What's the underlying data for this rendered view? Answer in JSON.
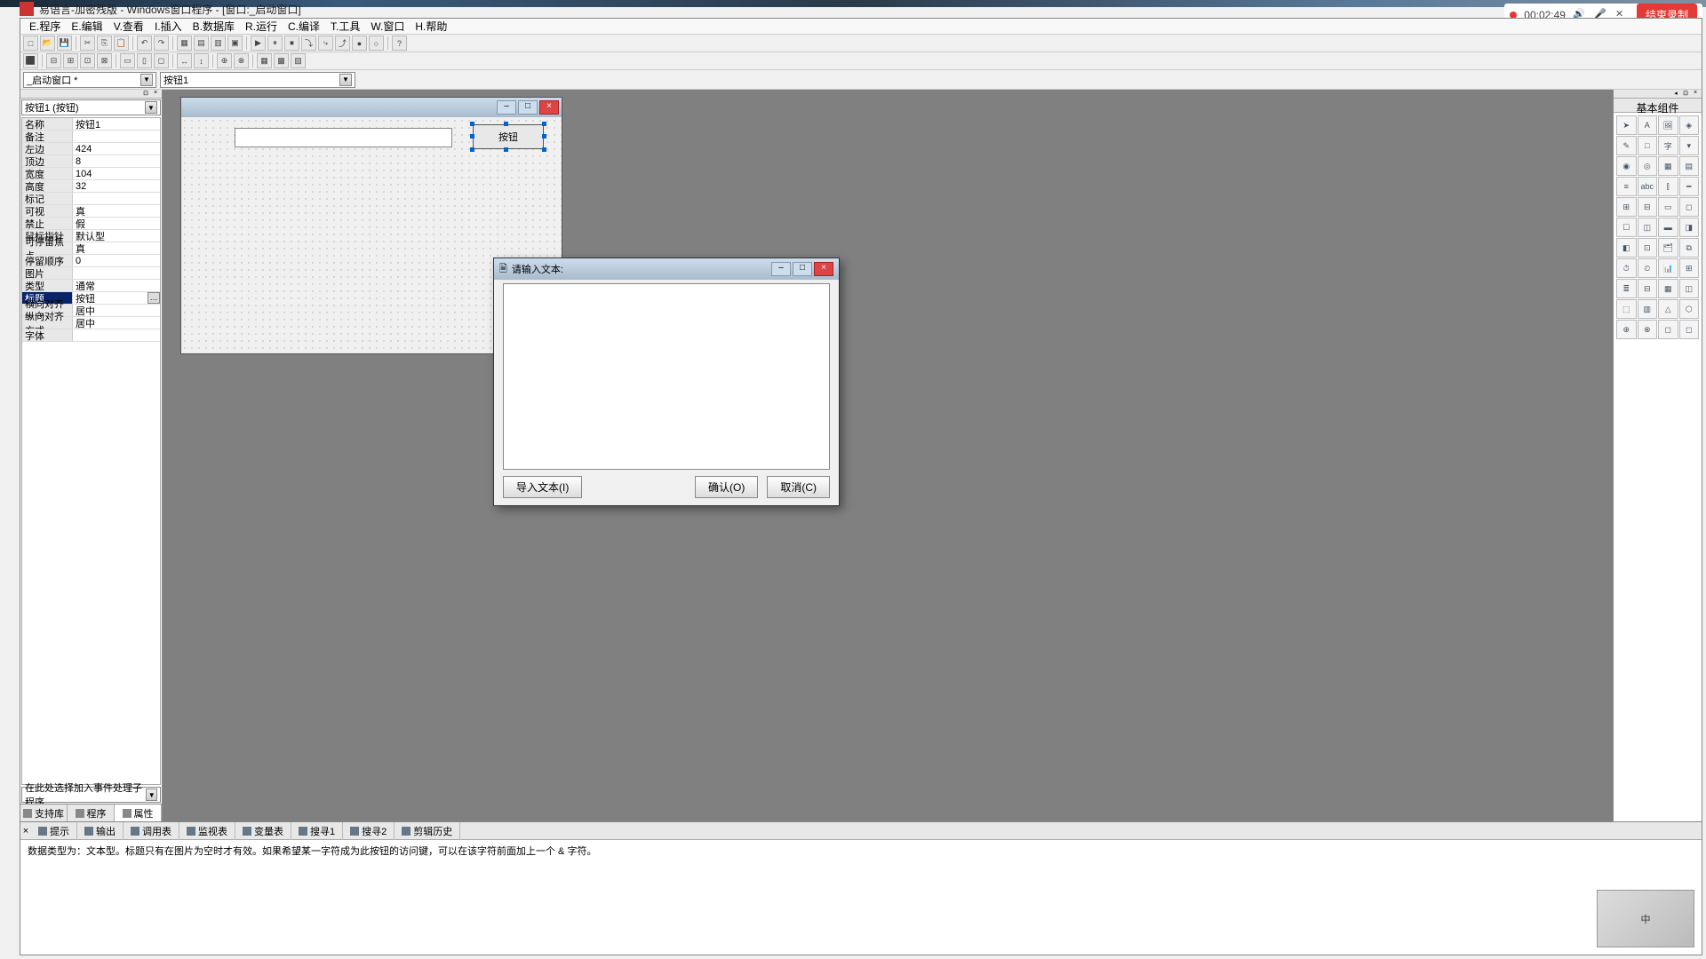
{
  "app": {
    "title": "易语言-加密残版 - Windows窗口程序 - [窗口:_启动窗口]"
  },
  "recorder": {
    "time": "00:02:49",
    "end": "结束录制"
  },
  "menus": [
    "E.程序",
    "E.编辑",
    "V.查看",
    "I.插入",
    "B.数据库",
    "R.运行",
    "C.编译",
    "T.工具",
    "W.窗口",
    "H.帮助"
  ],
  "combo1": "_启动窗口  *",
  "combo2": "按钮1",
  "object_selector": "按钮1  (按钮)",
  "properties": [
    {
      "k": "名称",
      "v": "按钮1"
    },
    {
      "k": "备注",
      "v": ""
    },
    {
      "k": "左边",
      "v": "424"
    },
    {
      "k": "顶边",
      "v": "8"
    },
    {
      "k": "宽度",
      "v": "104"
    },
    {
      "k": "高度",
      "v": "32"
    },
    {
      "k": "标记",
      "v": ""
    },
    {
      "k": "可视",
      "v": "真"
    },
    {
      "k": "禁止",
      "v": "假"
    },
    {
      "k": "鼠标指针",
      "v": "默认型"
    },
    {
      "k": "可停留焦点",
      "v": "真"
    },
    {
      "k": "停留顺序",
      "v": "0"
    },
    {
      "k": "图片",
      "v": ""
    },
    {
      "k": "类型",
      "v": "通常"
    },
    {
      "k": "标题",
      "v": "按钮",
      "sel": true,
      "ell": true
    },
    {
      "k": "横向对齐方式",
      "v": "居中"
    },
    {
      "k": "纵向对齐方式",
      "v": "居中"
    },
    {
      "k": "字体",
      "v": ""
    }
  ],
  "event_prompt": "在此处选择加入事件处理子程序",
  "left_tabs": [
    "支持库",
    "程序",
    "属性"
  ],
  "toolbox_title": "基本组件",
  "form_button_caption": "按钮",
  "bottom_tabs": [
    "提示",
    "输出",
    "调用表",
    "监视表",
    "变量表",
    "搜寻1",
    "搜寻2",
    "剪辑历史"
  ],
  "bottom_text": "数据类型为：文本型。标题只有在图片为空时才有效。如果希望某一字符成为此按钮的访问键，可以在该字符前面加上一个 & 字符。",
  "dialog": {
    "title": "请输入文本:",
    "import": "导入文本(I)",
    "ok": "确认(O)",
    "cancel": "取消(C)"
  },
  "watermark_text": "中"
}
